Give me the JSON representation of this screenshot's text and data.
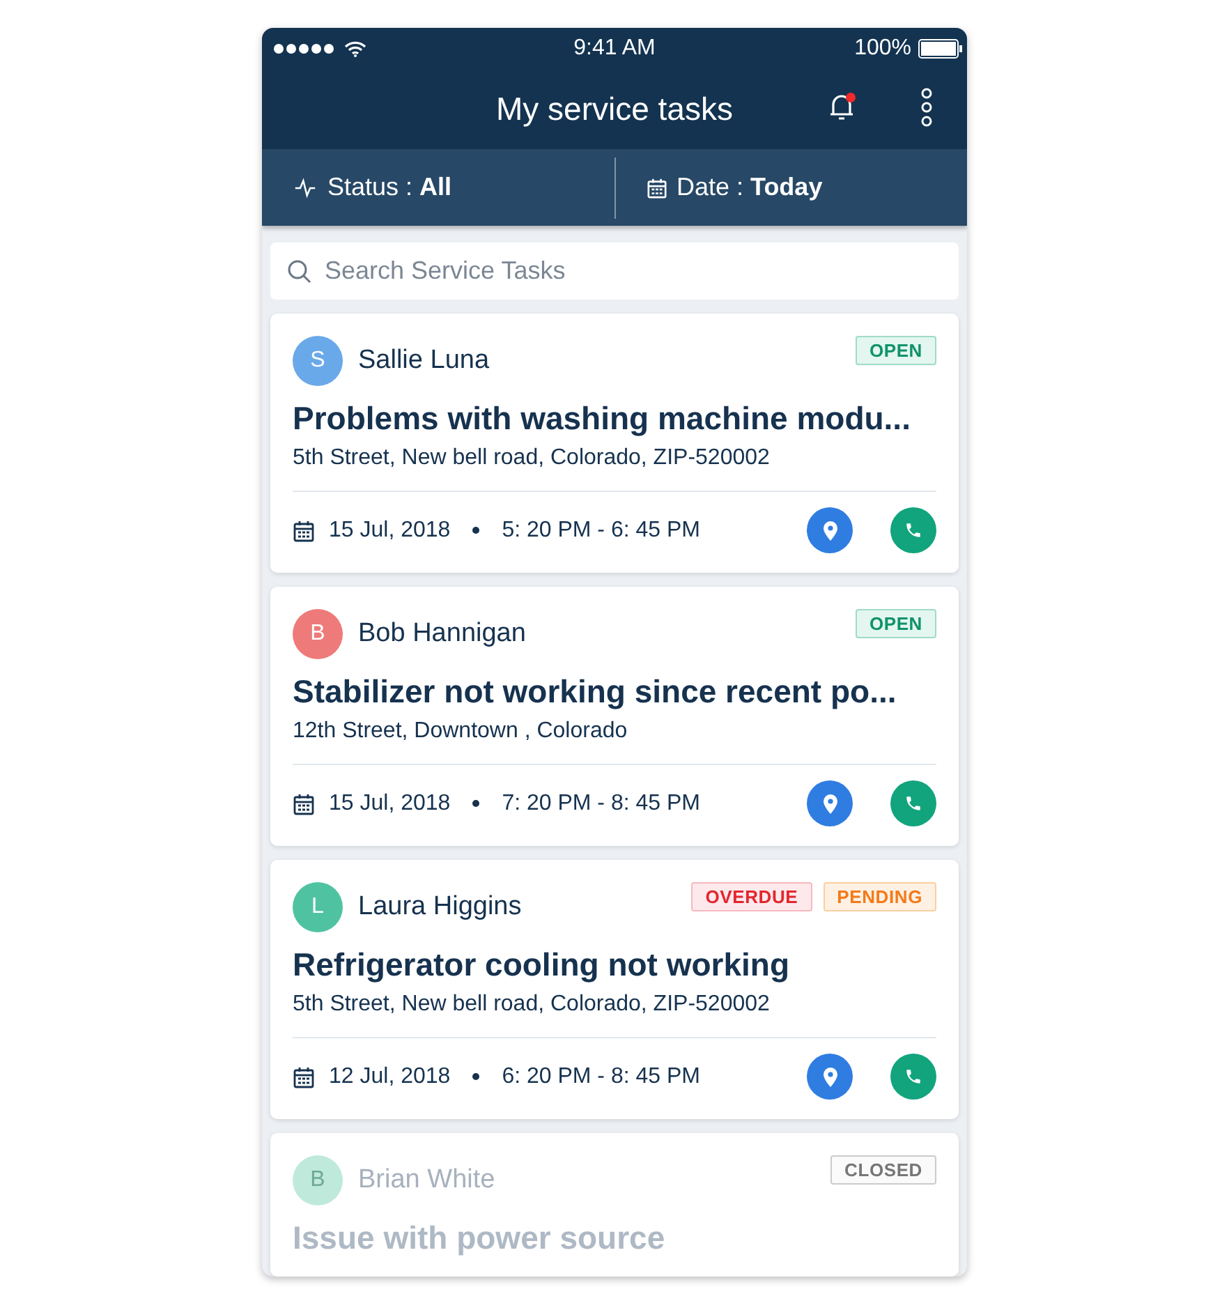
{
  "status_bar": {
    "time": "9:41 AM",
    "battery": "100%"
  },
  "header": {
    "title": "My service tasks",
    "unread_notifications": true
  },
  "filters": [
    {
      "kind": "status",
      "label": "Status :",
      "value": "All"
    },
    {
      "kind": "date",
      "label": "Date  :",
      "value": "Today"
    }
  ],
  "search": {
    "placeholder": "Search Service Tasks"
  },
  "tasks": [
    {
      "initial": "S",
      "color": "#6aa9e9",
      "name": "Sallie Luna",
      "tags": [
        {
          "kind": "open",
          "label": "OPEN"
        }
      ],
      "title": "Problems with washing machine modu...",
      "address": "5th Street, New bell road, Colorado, ZIP-520002",
      "date": "15 Jul, 2018",
      "time": "5: 20 PM - 6: 45 PM",
      "dimmed": false
    },
    {
      "initial": "B",
      "color": "#ee7a7a",
      "name": "Bob Hannigan",
      "tags": [
        {
          "kind": "open",
          "label": "OPEN"
        }
      ],
      "title": "Stabilizer not working since recent po...",
      "address": "12th Street, Downtown , Colorado",
      "date": "15 Jul, 2018",
      "time": "7: 20 PM - 8: 45 PM",
      "dimmed": false
    },
    {
      "initial": "L",
      "color": "#4fc3a1",
      "name": "Laura Higgins",
      "tags": [
        {
          "kind": "overdue",
          "label": "OVERDUE"
        },
        {
          "kind": "pending",
          "label": "PENDING"
        }
      ],
      "title": "Refrigerator cooling not working",
      "address": "5th Street, New bell road, Colorado, ZIP-520002",
      "date": "12 Jul, 2018",
      "time": "6: 20 PM - 8: 45 PM",
      "dimmed": false
    },
    {
      "initial": "B",
      "color": "#bfeadb",
      "name": "Brian White",
      "tags": [
        {
          "kind": "closed",
          "label": "CLOSED"
        }
      ],
      "title": "Issue with power source",
      "dimmed": true
    }
  ]
}
